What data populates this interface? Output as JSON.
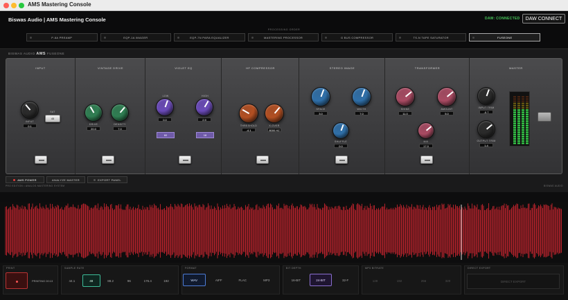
{
  "window": {
    "title": "AMS Mastering Console"
  },
  "header": {
    "app_name": "Biswas Audio | AMS Mastering Console",
    "daw_status": "DAW: CONNECTED",
    "daw_button": "DAW CONNECT"
  },
  "chain": {
    "label": "PROCESSING ORDER",
    "stages": [
      "P-8A PREAMP",
      "EQP-1A IMAGER",
      "EQP-7N PARA EQUALIZER",
      "MASTERING PROCESSOR",
      "G BUS COMPRESSOR",
      "TS-N TAPE SATURATOR",
      "FUSEONE"
    ],
    "active_index": 6
  },
  "rack": {
    "brand": "BISWAS AUDIO",
    "model": "AMS",
    "name": "FUSEONE"
  },
  "sections": {
    "input": {
      "title": "INPUT",
      "knob_label": "INPUT",
      "value": "0.1",
      "aux_label": "SAT",
      "aux_value": "45"
    },
    "vintage": {
      "title": "VINTAGE DRIVE",
      "k1": "DRIVE",
      "v1": "20.0",
      "k2": "DENSITY",
      "v2": "7.0"
    },
    "violet": {
      "title": "VIOLET EQ",
      "k1": "LOW",
      "k2": "HIGH",
      "g1": "GAIN",
      "v1": "0.0",
      "g2": "GAIN",
      "v2": "2.9",
      "f1": "60",
      "f2": "18"
    },
    "comp": {
      "title": "HF COMPRESSOR",
      "k1": "THRESHOLD",
      "v1": "-4.1",
      "k2": "X-OVER",
      "v2": "8000 HZ"
    },
    "stereo": {
      "title": "STEREO IMAGE",
      "k1": "SPACE",
      "v1": "3.0",
      "k2": "WIDTH",
      "v2": "7.0",
      "k3": "SHUFFLE",
      "v3": "0.0"
    },
    "transformer": {
      "title": "TRANSFORMER",
      "k1": "SHINE",
      "v1": "11.0",
      "k2": "AMOUNT",
      "v2": "5.0",
      "k3": "MIX",
      "v3": "17.0"
    },
    "master": {
      "title": "MASTER",
      "k1": "INPUT TRIM",
      "v1": "-0.7",
      "k2": "OUTPUT TRIM",
      "v2": "1.4"
    }
  },
  "footer": {
    "power": "AMS POWER",
    "analyzer": "ANALYZE MASTER",
    "export": "EXPORT PANEL",
    "note_left": "PRO EDITION  •  ANALOG MASTERING SYSTEM",
    "note_right": "BISWAS AUDIO"
  },
  "export": {
    "print": {
      "title": "PRINT",
      "status": "PRINTING 00:13"
    },
    "rate": {
      "title": "SAMPLE RATE",
      "options": [
        "44.1",
        "48",
        "88.2",
        "96",
        "176.4",
        "192"
      ],
      "selected": "48"
    },
    "format": {
      "title": "FORMAT",
      "options": [
        "WAV",
        "AIFF",
        "FLAC",
        "MP3"
      ],
      "selected": "WAV"
    },
    "depth": {
      "title": "BIT DEPTH",
      "options": [
        "16-BIT",
        "24-BIT",
        "32-F"
      ],
      "selected": "24-BIT"
    },
    "mp3": {
      "title": "MP3 BITRATE",
      "options": [
        "128",
        "192",
        "256",
        "320"
      ]
    },
    "direct": {
      "title": "DIRECT EXPORT",
      "button": "DIRECT EXPORT"
    }
  },
  "colors": {
    "accent_green": "#3dbd9a",
    "accent_blue": "#4d7cd6",
    "accent_purple": "#8b6fd1",
    "waveform": "#b3212b",
    "daw_connected": "#48c65a"
  }
}
